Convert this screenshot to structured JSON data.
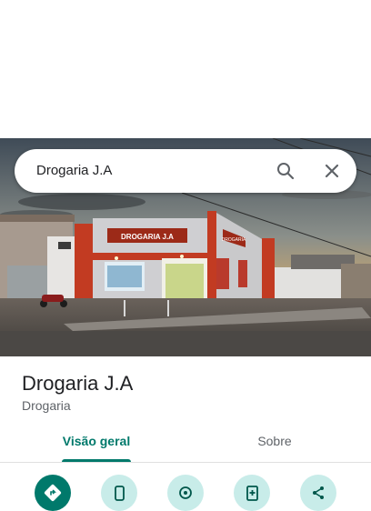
{
  "search": {
    "value": "Drogaria J.A",
    "search_icon": "search-icon",
    "clear_icon": "close-icon"
  },
  "hero": {
    "image": "storefront-photo",
    "sign_text": "DROGARIA J.A",
    "side_sign_text": "DROGARIA"
  },
  "place": {
    "name": "Drogaria J.A",
    "category": "Drogaria"
  },
  "tabs": [
    {
      "label": "Visão geral",
      "selected": true
    },
    {
      "label": "Sobre",
      "selected": false
    }
  ],
  "actions": [
    {
      "icon": "directions-icon",
      "primary": true
    },
    {
      "icon": "phone-icon",
      "primary": false
    },
    {
      "icon": "location-icon",
      "primary": false
    },
    {
      "icon": "save-icon",
      "primary": false
    },
    {
      "icon": "share-icon",
      "primary": false
    }
  ],
  "colors": {
    "accent": "#00796b",
    "accent_light": "#c8ece9",
    "text_primary": "#202124",
    "text_secondary": "#5f6368"
  }
}
